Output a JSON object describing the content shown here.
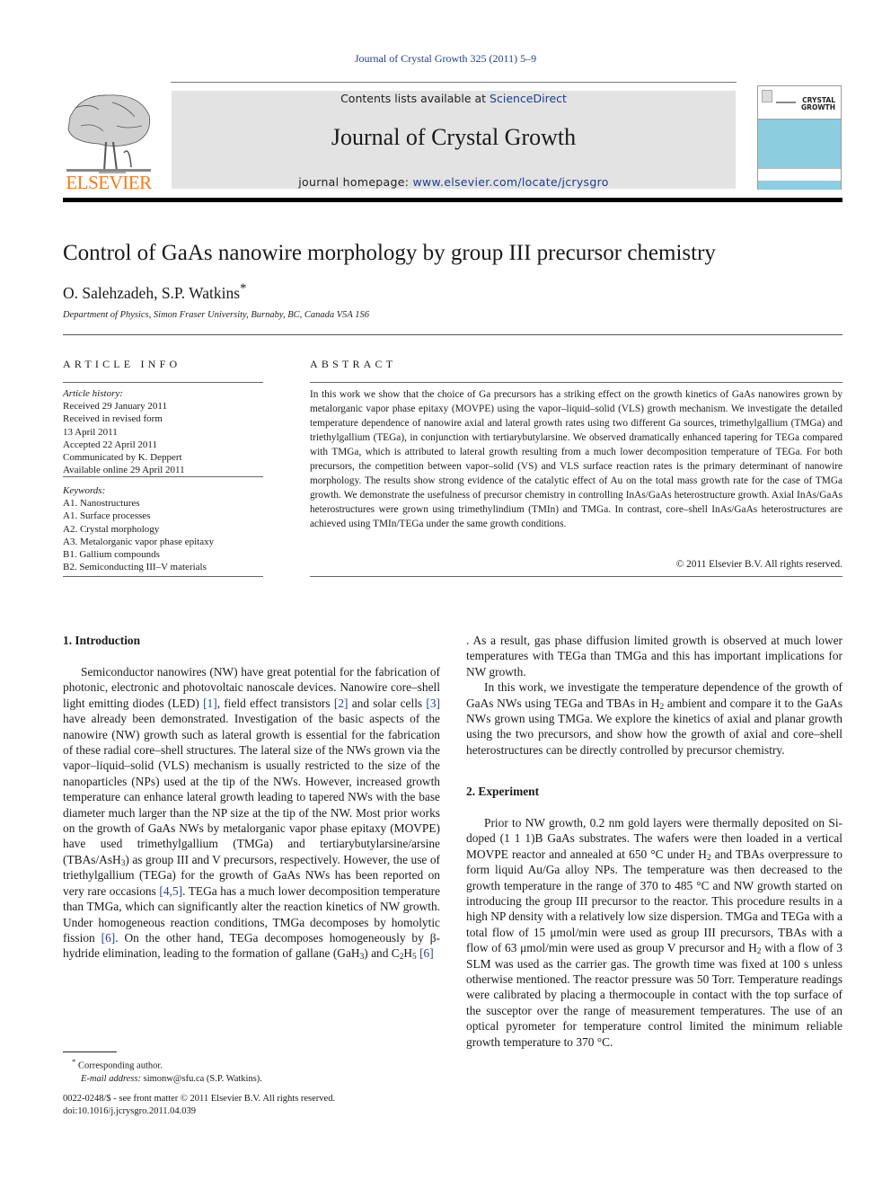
{
  "header": {
    "running_head": "Journal of Crystal Growth 325 (2011) 5–9",
    "contents_prefix": "Contents lists available at ",
    "contents_link": "ScienceDirect",
    "journal_title": "Journal of Crystal Growth",
    "homepage_prefix": "journal homepage: ",
    "homepage_link": "www.elsevier.com/locate/jcrysgro",
    "publisher_logo_text": "ELSEVIER",
    "cover_title_line1": "CRYSTAL",
    "cover_title_line2": "GROWTH",
    "colors": {
      "publisher_orange": "#f07c1c",
      "link_blue": "#1e3f8e",
      "cover_blue": "#8ccde0",
      "masthead_gray": "#e3e3e3"
    }
  },
  "article": {
    "title": "Control of GaAs nanowire morphology by group III precursor chemistry",
    "authors": "O. Salehzadeh, S.P. Watkins",
    "author_mark": "*",
    "affiliation": "Department of Physics, Simon Fraser University, Burnaby, BC, Canada V5A 1S6"
  },
  "article_info": {
    "heading": "ARTICLE INFO",
    "history_label": "Article history:",
    "history": [
      "Received 29 January 2011",
      "Received in revised form",
      "13 April 2011",
      "Accepted 22 April 2011",
      "Communicated by K. Deppert",
      "Available online 29 April 2011"
    ],
    "keywords_label": "Keywords:",
    "keywords": [
      "A1. Nanostructures",
      "A1. Surface processes",
      "A2. Crystal morphology",
      "A3. Metalorganic vapor phase epitaxy",
      "B1. Gallium compounds",
      "B2. Semiconducting III–V materials"
    ]
  },
  "abstract": {
    "heading": "ABSTRACT",
    "text": "In this work we show that the choice of Ga precursors has a striking effect on the growth kinetics of GaAs nanowires grown by metalorganic vapor phase epitaxy (MOVPE) using the vapor–liquid–solid (VLS) growth mechanism. We investigate the detailed temperature dependence of nanowire axial and lateral growth rates using two different Ga sources, trimethylgallium (TMGa) and triethylgallium (TEGa), in conjunction with tertiarybutylarsine. We observed dramatically enhanced tapering for TEGa compared with TMGa, which is attributed to lateral growth resulting from a much lower decomposition temperature of TEGa. For both precursors, the competition between vapor–solid (VS) and VLS surface reaction rates is the primary determinant of nanowire morphology. The results show strong evidence of the catalytic effect of Au on the total mass growth rate for the case of TMGa growth. We demonstrate the usefulness of precursor chemistry in controlling InAs/GaAs heterostructure growth. Axial InAs/GaAs heterostructures were grown using trimethylindium (TMIn) and TMGa. In contrast, core–shell InAs/GaAs heterostructures are achieved using TMIn/TEGa under the same growth conditions.",
    "copyright": "© 2011 Elsevier B.V. All rights reserved."
  },
  "sections": {
    "intro": {
      "heading": "1.   Introduction",
      "p1_a": "Semiconductor nanowires (NW) have great potential for the fabrication of photonic, electronic and photovoltaic nanoscale devices. Nanowire core–shell light emitting diodes (LED) ",
      "ref1": "[1]",
      "p1_b": ", field effect transistors ",
      "ref2": "[2]",
      "p1_c": " and solar cells ",
      "ref3": "[3]",
      "p1_d": " have already been demonstrated. Investigation of the basic aspects of the nanowire (NW) growth such as lateral growth is essential for the fabrication of these radial core–shell structures. The lateral size of the NWs grown via the vapor–liquid–solid (VLS) mechanism is usually restricted to the size of the nanoparticles (NPs) used at the tip of the NWs. However, increased growth temperature can enhance lateral growth leading to tapered NWs with the base diameter much larger than the NP size at the tip of the NW. Most prior works on the growth of GaAs NWs by metalorganic vapor phase epitaxy (MOVPE) have used trimethylgallium (TMGa) and tertiarybutylarsine/arsine (TBAs/AsH",
      "sub3a": "3",
      "p1_e": ") as group III and V precursors, respectively. However, the use of triethylgallium (TEGa) for the growth of GaAs NWs has been reported on very rare occasions ",
      "ref45": "[4,5]",
      "p1_f": ". TEGa has a much lower decomposition temperature than TMGa, which can significantly alter the reaction kinetics of NW growth. Under homogeneous reaction conditions, TMGa decomposes by homolytic fission ",
      "ref6a": "[6]",
      "p1_g": ". On the other hand, TEGa decomposes homogeneously by β-hydride elimination, leading to the formation of gallane (GaH",
      "sub3b": "3",
      "p1_h": ") and C",
      "sub2": "2",
      "p1_i": "H",
      "sub5": "5",
      "p1_j": " ",
      "ref6b": "[6]",
      "p1_k": ". As a result, gas phase diffusion limited growth is observed at much lower temperatures with TEGa than TMGa and this has important implications for NW growth.",
      "p2_a": "In this work, we investigate the temperature dependence of the growth of GaAs NWs using TEGa and TBAs in H",
      "p2_sub": "2",
      "p2_b": " ambient and compare it to the GaAs NWs grown using TMGa. We explore the kinetics of axial and planar growth using the two precursors, and show how the growth of axial and core–shell heterostructures can be directly controlled by precursor chemistry."
    },
    "experiment": {
      "heading": "2.   Experiment",
      "a": "Prior to NW growth, 0.2 nm gold layers were thermally deposited on Si-doped (1 1 1)B GaAs substrates. The wafers were then loaded in a vertical MOVPE reactor and annealed at 650 °C under H",
      "sub_a": "2",
      "b": " and TBAs overpressure to form liquid Au/Ga alloy NPs. The temperature was then decreased to the growth temperature in the range of 370 to 485 °C and NW growth started on introducing the group III precursor to the reactor. This procedure results in a high NP density with a relatively low size dispersion. TMGa and TEGa with a total flow of 15 μmol/min were used as group III precursors, TBAs with a flow of 63 μmol/min were used as group V precursor and H",
      "sub_b": "2",
      "c": " with a flow of 3 SLM was used as the carrier gas. The growth time was fixed at 100 s unless otherwise mentioned. The reactor pressure was 50 Torr. Temperature readings were calibrated by placing a thermocouple in contact with the top surface of the susceptor over the range of measurement temperatures. The use of an optical pyrometer for temperature control limited the minimum reliable growth temperature to 370 °C."
    }
  },
  "footnote": {
    "mark": "*",
    "corresponding": " Corresponding author.",
    "email_label": "E-mail address:",
    "email": " simonw@sfu.ca (S.P. Watkins)."
  },
  "front_matter": {
    "issn_line": "0022-0248/$ - see front matter © 2011 Elsevier B.V. All rights reserved.",
    "doi": "doi:10.1016/j.jcrysgro.2011.04.039"
  }
}
